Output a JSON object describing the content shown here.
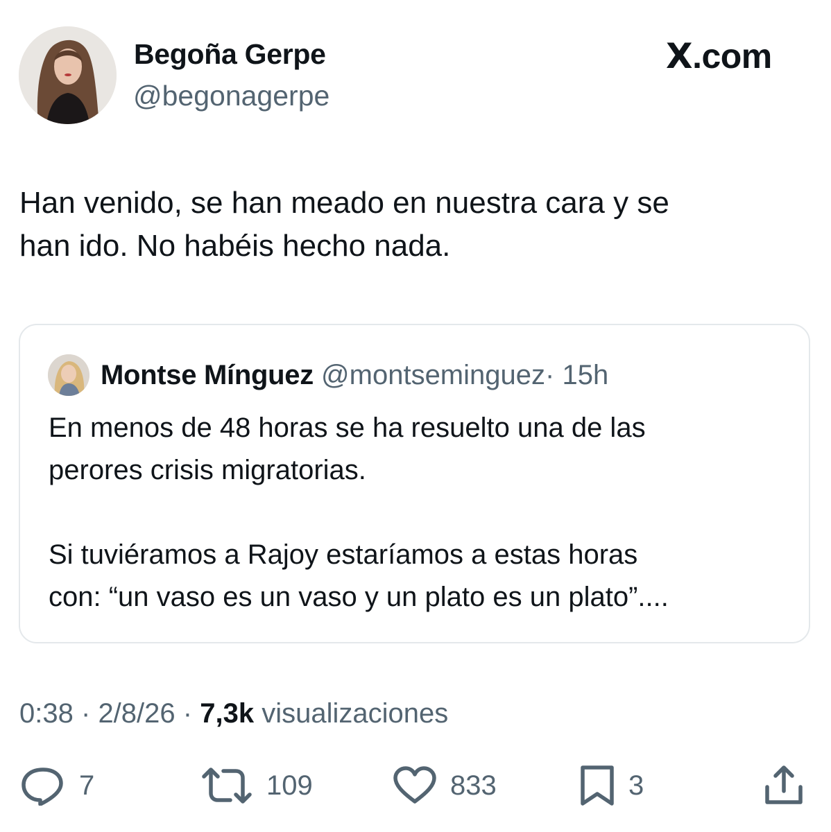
{
  "author": {
    "name": "Begoña Gerpe",
    "handle": "@begonagerpe"
  },
  "brand": {
    "logo_letter": "X",
    "suffix": ".com"
  },
  "tweet": {
    "text": "Han venido, se han meado en nuestra cara y se\nhan ido. No habéis hecho nada."
  },
  "quoted_tweet": {
    "name": "Montse Mínguez",
    "handle": "@montseminguez",
    "separator": "·",
    "time": "15h",
    "text": "En menos de 48 horas se ha resuelto una de las\nperores crisis migratorias.\n\nSi tuviéramos a Rajoy estaríamos a estas horas\ncon: “un vaso es un vaso y un plato es un plato”...."
  },
  "meta": {
    "time": "0:38",
    "date": "2/8/26",
    "separator": "·",
    "views": "7,3k",
    "views_label": "visualizaciones"
  },
  "actions": {
    "replies": {
      "icon": "reply-icon",
      "count": "7"
    },
    "reposts": {
      "icon": "repost-icon",
      "count": "109"
    },
    "likes": {
      "icon": "heart-icon",
      "count": "833"
    },
    "bookmarks": {
      "icon": "bookmark-icon",
      "count": "3"
    },
    "share": {
      "icon": "share-icon"
    }
  },
  "colors": {
    "text_primary": "#0f1419",
    "text_secondary": "#536471",
    "border": "#e4e8eb",
    "background": "#ffffff"
  }
}
